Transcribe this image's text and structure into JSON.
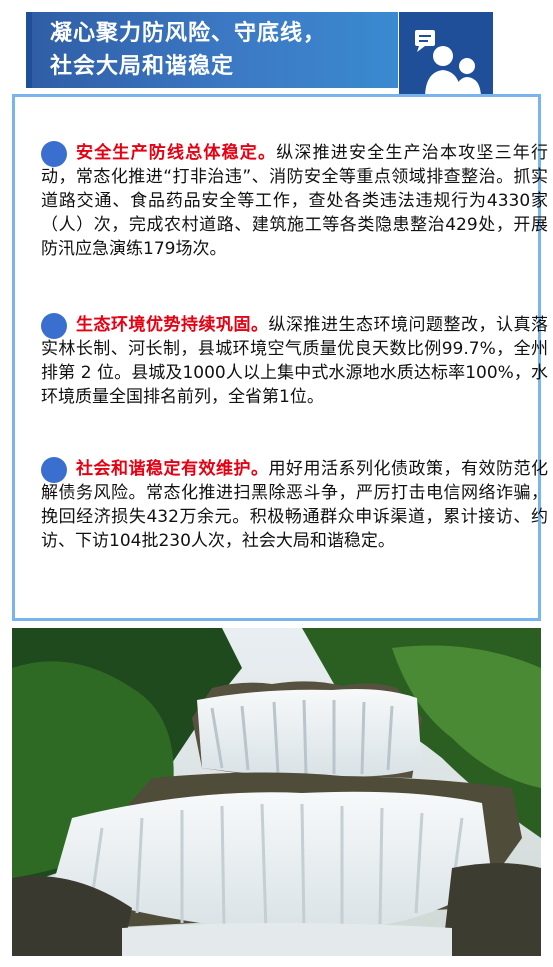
{
  "header": {
    "title_line1": "凝心聚力防风险、守底线，",
    "title_line2": "社会大局和谐稳定",
    "icon": "people-chat-icon"
  },
  "sections": [
    {
      "heading": "安全生产防线总体稳定。",
      "body": "纵深推进安全生产治本攻坚三年行动，常态化推进“打非治违”、消防安全等重点领域排查整治。抓实道路交通、食品药品安全等工作，查处各类违法违规行为4330家（人）次，完成农村道路、建筑施工等各类隐患整治429处，开展防汛应急演练179场次。"
    },
    {
      "heading": "生态环境优势持续巩固。",
      "body": "纵深推进生态环境问题整改，认真落实林长制、河长制，县城环境空气质量优良天数比例99.7%，全州排第 2 位。县城及1000人以上集中式水源地水质达标率100%，水环境质量全国排名前列，全省第1位。"
    },
    {
      "heading": "社会和谐稳定有效维护。",
      "body": "用好用活系列化债政策，有效防范化解债务风险。常态化推进扫黑除恶斗争，严厉打击电信网络诈骗，挽回经济损失432万余元。积极畅通群众申诉渠道，累计接访、约访、下访104批230人次，社会大局和谐稳定。"
    }
  ],
  "photo": {
    "subject": "waterfall-photo"
  },
  "colors": {
    "banner": "#3c79c4",
    "accent": "#1f4f98",
    "heading": "#e60012",
    "bullet": "#3a6fd0",
    "border": "#79b5ec"
  }
}
